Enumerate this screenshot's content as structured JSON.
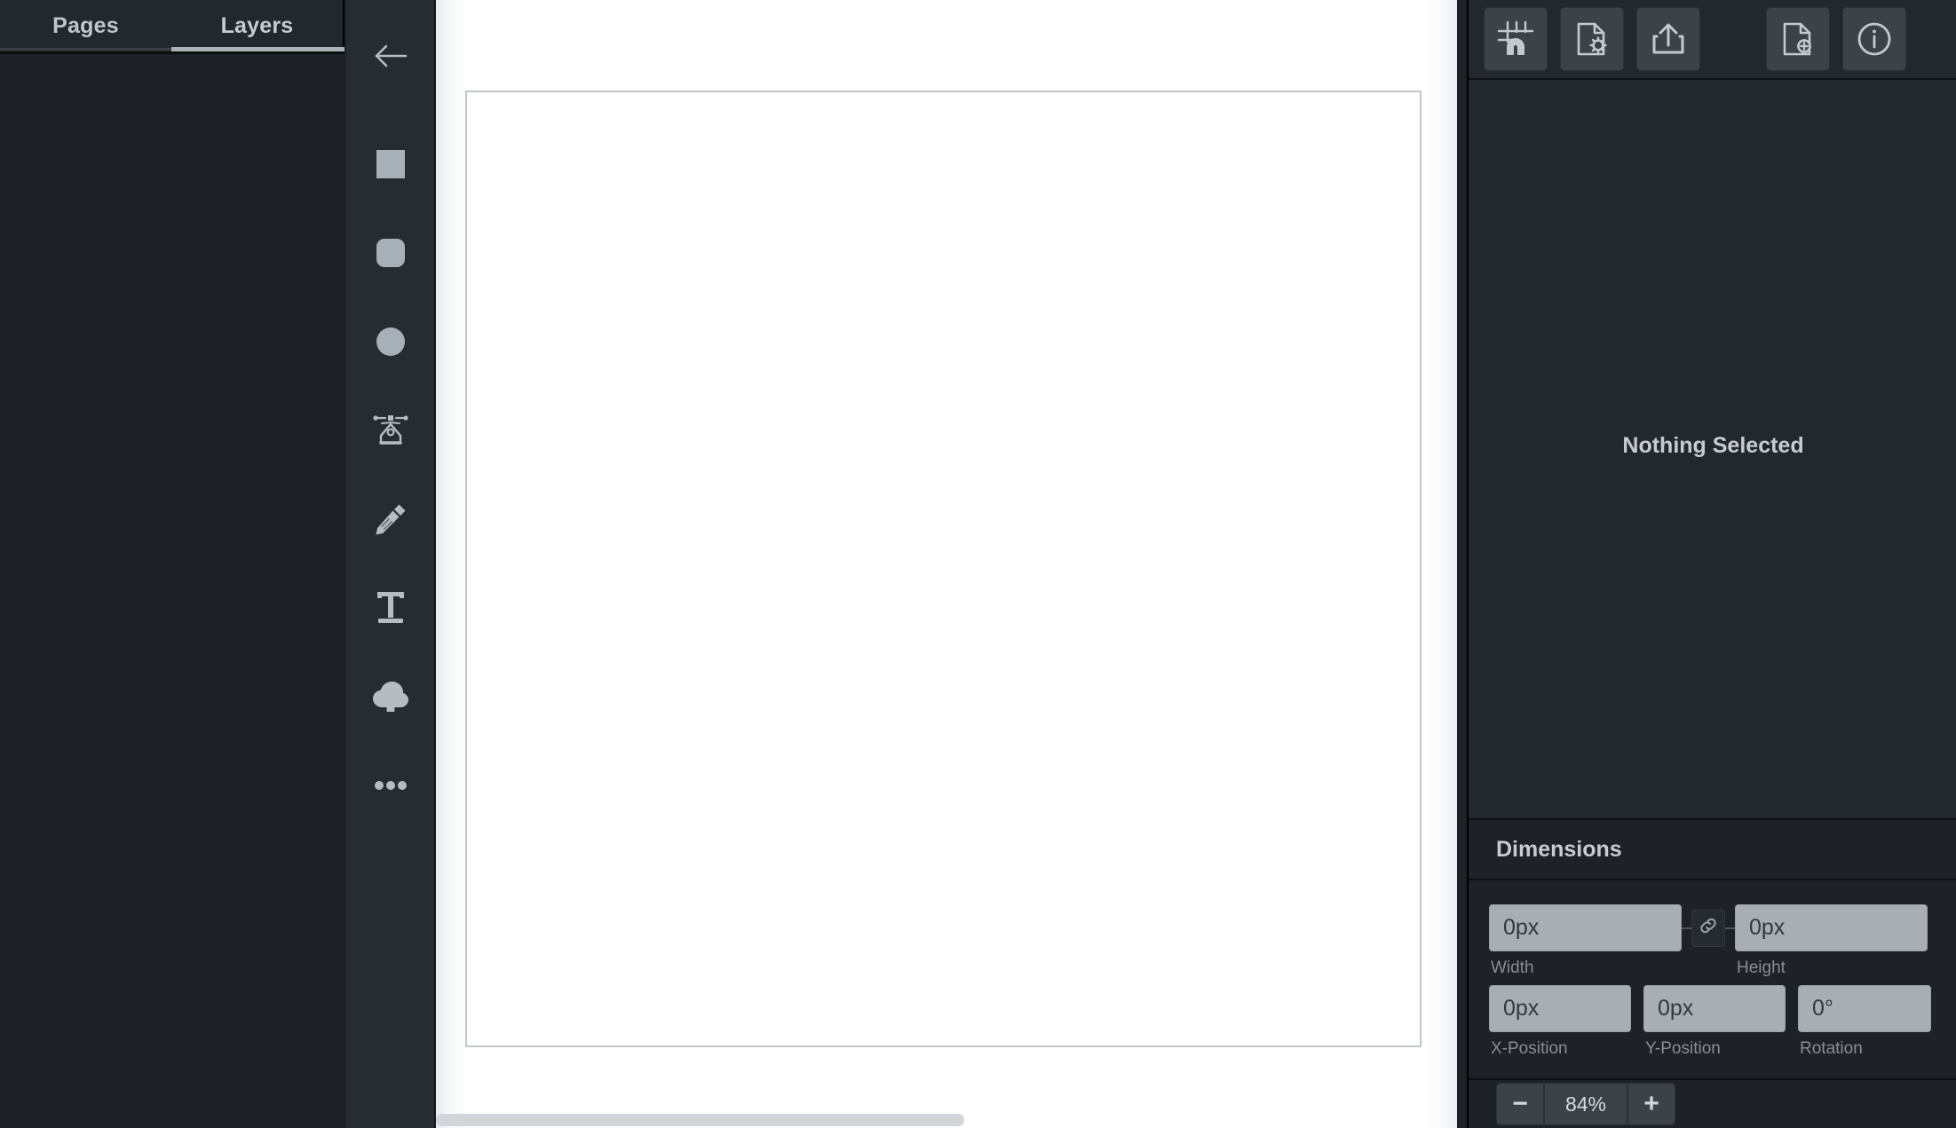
{
  "colors": {
    "panel_bg": "#1e2226",
    "panel_alt_bg": "#23282d",
    "rail_bg": "#272c31",
    "button_bg": "#3b4248",
    "icon": "#b6bcc2",
    "text": "#c8ccd0",
    "muted_text": "#878d93",
    "input_bg": "#a9aeb2",
    "input_text": "#34383c",
    "divider": "#0c0e11",
    "canvas_bg": "#ffffff",
    "artboard_border": "#c3c6c9",
    "active_tab_underline": "#a9b0b7"
  },
  "sidebar": {
    "tabs": [
      {
        "label": "Pages",
        "active": false,
        "name": "tab-pages"
      },
      {
        "label": "Layers",
        "active": true,
        "name": "tab-layers"
      }
    ],
    "layer_list": {
      "items": []
    }
  },
  "tool_rail": {
    "tools": [
      {
        "label": "Back",
        "icon": "arrow-left-icon"
      },
      {
        "label": "Rectangle",
        "icon": "square-icon"
      },
      {
        "label": "Rounded Rectangle",
        "icon": "rounded-square-icon"
      },
      {
        "label": "Ellipse",
        "icon": "circle-icon"
      },
      {
        "label": "Pen",
        "icon": "pen-icon"
      },
      {
        "label": "Pencil",
        "icon": "pencil-icon"
      },
      {
        "label": "Text",
        "icon": "text-icon"
      },
      {
        "label": "Upload",
        "icon": "cloud-upload-icon"
      },
      {
        "label": "More",
        "icon": "more-icon"
      }
    ]
  },
  "canvas": {
    "artboard_label": "",
    "h_scrollbar": {
      "name": "canvas-horizontal-scrollbar"
    },
    "v_scrollbar": {
      "name": "canvas-vertical-scrollbar"
    }
  },
  "right_panel": {
    "toolbar": [
      {
        "label": "Snap to Grid",
        "icon": "grid-magnet-icon"
      },
      {
        "label": "Document Settings",
        "icon": "file-gear-icon"
      },
      {
        "label": "Export",
        "icon": "export-upload-icon"
      },
      {
        "label": "New Document",
        "icon": "file-plus-icon"
      },
      {
        "label": "Info",
        "icon": "info-icon"
      }
    ],
    "selection": {
      "empty_message": "Nothing Selected"
    },
    "dimensions": {
      "title": "Dimensions",
      "link_icon": "link-icon",
      "fields": [
        {
          "label": "Width",
          "value": "0px",
          "placeholder": "0px"
        },
        {
          "label": "Height",
          "value": "0px",
          "placeholder": "0px"
        },
        {
          "label": "X-Position",
          "value": "0px",
          "placeholder": "0px"
        },
        {
          "label": "Y-Position",
          "value": "0px",
          "placeholder": "0px"
        },
        {
          "label": "Rotation",
          "value": "0°",
          "placeholder": "0°"
        }
      ]
    },
    "zoom": {
      "decrease_label": "−",
      "value": "84%",
      "increase_label": "+"
    }
  }
}
